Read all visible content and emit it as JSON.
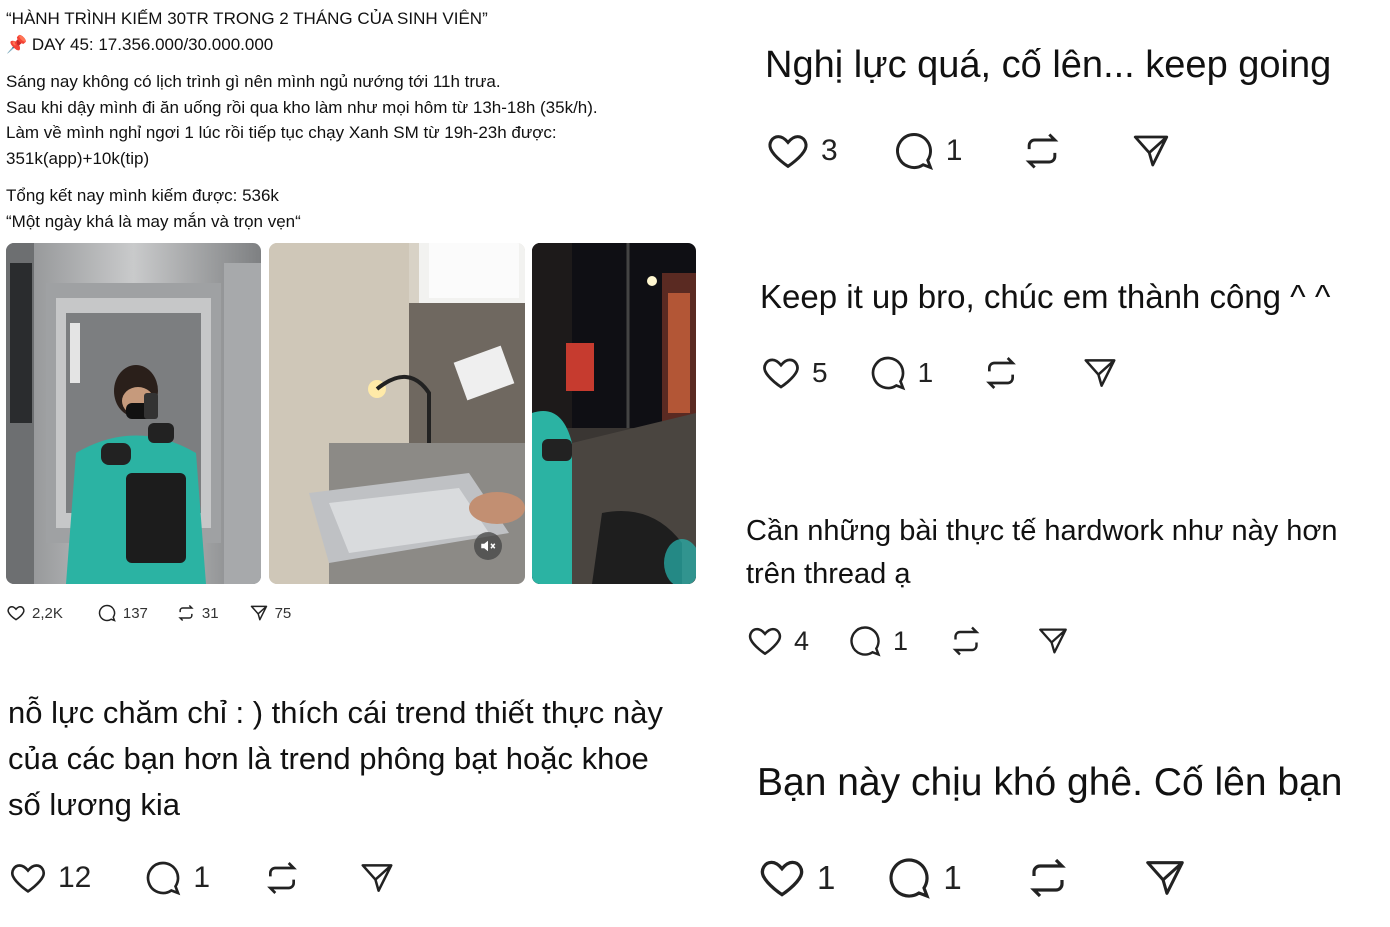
{
  "post": {
    "lines": [
      "“HÀNH TRÌNH KIẾM 30TR TRONG 2 THÁNG CỦA SINH VIÊN”",
      "📌 DAY 45: 17.356.000/30.000.000",
      "Sáng nay không có lịch trình gì nên mình ngủ nướng tới 11h trưa.",
      "Sau khi dậy mình đi ăn uống rồi qua kho làm như mọi hôm từ 13h-18h (35k/h).",
      "Làm về mình nghỉ ngơi 1 lúc rồi tiếp tục chạy Xanh SM từ 19h-23h được:",
      "351k(app)+10k(tip)",
      "Tổng kết nay mình kiếm được: 536k",
      "“Một ngày khá là may mắn và trọn vẹn“"
    ],
    "stats": {
      "likes": "2,2K",
      "replies": "137",
      "reposts": "31",
      "shares": "75"
    }
  },
  "comments": [
    {
      "lines": [
        "nỗ lực chăm chỉ : ) thích cái trend thiết thực này",
        "của các bạn hơn là trend phông bạt hoặc khoe",
        "số lương kia"
      ],
      "likes": "12",
      "replies": "1"
    },
    {
      "lines": [
        "Nghị lực quá, cố lên... keep going"
      ],
      "likes": "3",
      "replies": "1"
    },
    {
      "lines": [
        "Keep it up bro, chúc em thành công ^ ^"
      ],
      "likes": "5",
      "replies": "1"
    },
    {
      "lines": [
        "Cần những bài thực tế hardwork như này hơn",
        "trên thread ạ"
      ],
      "likes": "4",
      "replies": "1"
    },
    {
      "lines": [
        "Bạn này chịu khó ghê. Cố lên bạn"
      ],
      "likes": "1",
      "replies": "1"
    }
  ],
  "icons": {
    "like": "heart-icon",
    "reply": "speech-bubble-icon",
    "repost": "repost-icon",
    "share": "send-icon",
    "mute": "muted-speaker-icon",
    "pin": "pushpin-emoji"
  },
  "colors": {
    "text": "#111111",
    "icon": "#222222",
    "jacket": "#2bb3a3"
  }
}
